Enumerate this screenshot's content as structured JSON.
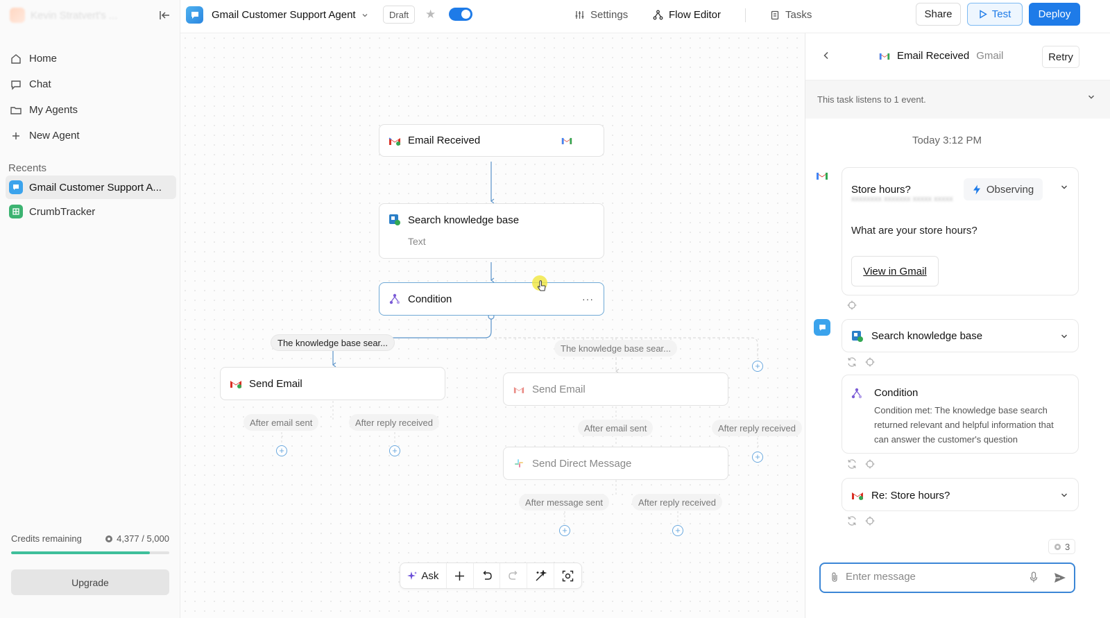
{
  "sidebar": {
    "workspace_name": "Kevin Stratvert's ...",
    "nav": [
      {
        "label": "Home",
        "icon": "home-icon"
      },
      {
        "label": "Chat",
        "icon": "chat-icon"
      },
      {
        "label": "My Agents",
        "icon": "folder-icon"
      },
      {
        "label": "New Agent",
        "icon": "plus-icon"
      }
    ],
    "recents_label": "Recents",
    "recents": [
      {
        "label": "Gmail Customer Support A...",
        "active": true
      },
      {
        "label": "CrumbTracker",
        "active": false
      }
    ],
    "credits_label": "Credits remaining",
    "credits_value": "4,377 / 5,000",
    "credits_fraction": 0.875,
    "upgrade_label": "Upgrade"
  },
  "topbar": {
    "agent_name": "Gmail Customer Support Agent",
    "status": "Draft",
    "enabled": true,
    "nav": {
      "settings": "Settings",
      "flow_editor": "Flow Editor",
      "tasks": "Tasks"
    },
    "share": "Share",
    "test": "Test",
    "deploy": "Deploy"
  },
  "canvas": {
    "nodes": {
      "email_received": "Email Received",
      "search_kb": "Search knowledge base",
      "search_kb_sub": "Text",
      "condition": "Condition",
      "condition_more": "···",
      "send_email_left": "Send Email",
      "send_email_right": "Send Email",
      "send_dm": "Send Direct Message"
    },
    "branches": {
      "left": "The knowledge base sear...",
      "right": "The knowledge base sear..."
    },
    "labels": {
      "after_email_sent_left": "After email sent",
      "after_reply_received_left": "After reply received",
      "after_email_sent_right": "After email sent",
      "after_reply_received_right": "After reply received",
      "after_message_sent": "After message sent",
      "after_reply_received_dm": "After reply received"
    },
    "toolbar": {
      "ask": "Ask"
    }
  },
  "panel": {
    "title": "Email Received",
    "subtitle": "Gmail",
    "retry": "Retry",
    "listens": "This task listens to 1 event.",
    "timestamp": "Today 3:12 PM",
    "email_card": {
      "subject": "Store hours?",
      "status": "Observing",
      "blurred_preview": "xxxxxxxx xxxxxxx xxxxx xxxxx",
      "body": "What are your store hours?",
      "view_link": "View in Gmail"
    },
    "steps": {
      "search_kb": "Search knowledge base",
      "condition_title": "Condition",
      "condition_text": "Condition met: The knowledge base search returned relevant and helpful information that can answer the customer's question",
      "reply_title": "Re: Store hours?"
    },
    "count": "3",
    "input_placeholder": "Enter message"
  },
  "colors": {
    "accent": "#1e7be8",
    "credits": "#3fbf9b"
  }
}
